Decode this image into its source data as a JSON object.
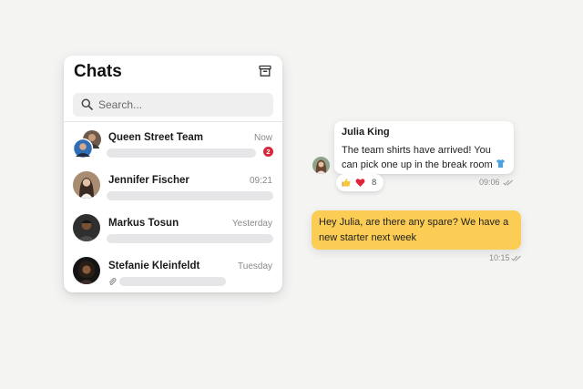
{
  "colors": {
    "background": "#f4f4f3",
    "panel": "#ffffff",
    "unread_badge": "#d6283b",
    "outgoing_bubble": "#fbcd54",
    "placeholder_bar": "#e6e6e8"
  },
  "chats_panel": {
    "title": "Chats",
    "archive_icon": "archive-icon",
    "search": {
      "placeholder": "Search...",
      "value": "",
      "icon": "search-icon"
    },
    "items": [
      {
        "name": "Queen Street Team",
        "time": "Now",
        "unread": "2",
        "preview_redacted": true
      },
      {
        "name": "Jennifer Fischer",
        "time": "09:21",
        "preview_redacted": true
      },
      {
        "name": "Markus Tosun",
        "time": "Yesterday",
        "preview_redacted": true
      },
      {
        "name": "Stefanie Kleinfeldt",
        "time": "Tuesday",
        "attachment_icon": "paperclip-icon",
        "preview_redacted": true
      }
    ]
  },
  "conversation": {
    "incoming": {
      "sender": "Julia King",
      "text": "The team shirts have arrived! You can pick one up in the break room",
      "emoji": "shirt-icon",
      "reactions": {
        "icons": [
          "thumbs-up-icon",
          "heart-icon"
        ],
        "count": "8"
      },
      "time": "09:06",
      "status_icon": "double-check-icon"
    },
    "outgoing": {
      "text": "Hey Julia, are there any spare? We have a new starter next week",
      "time": "10:15",
      "status_icon": "double-check-icon"
    }
  }
}
